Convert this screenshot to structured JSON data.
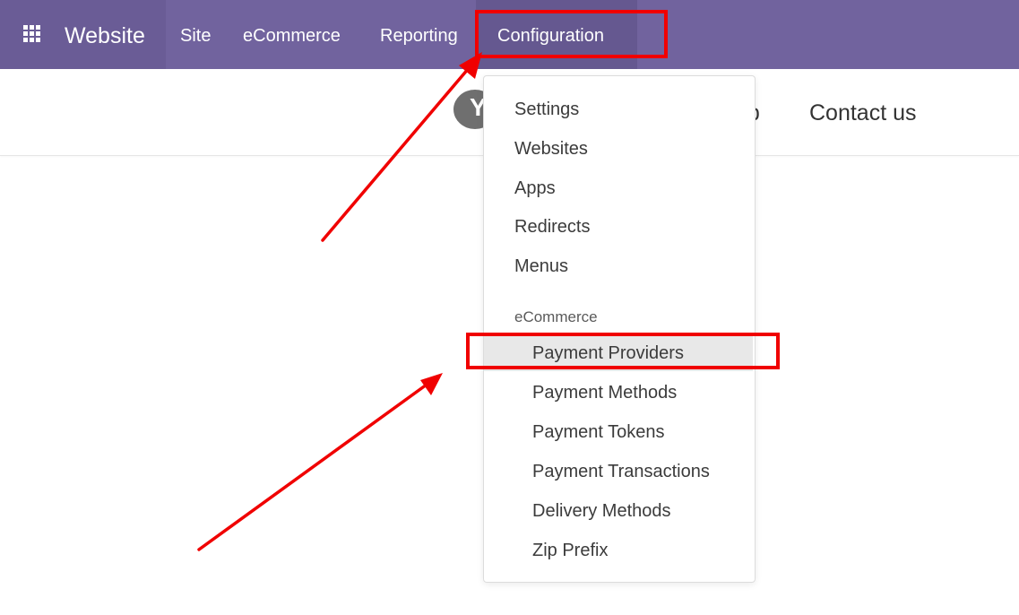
{
  "navbar": {
    "brand": "Website",
    "items": [
      {
        "label": "Site"
      },
      {
        "label": "eCommerce"
      },
      {
        "label": "Reporting"
      },
      {
        "label": "Configuration",
        "active": true
      }
    ],
    "apps_icon": "grid-icon"
  },
  "header": {
    "logo_letter": "Y",
    "links": [
      {
        "label": "op"
      },
      {
        "label": "Contact us"
      }
    ]
  },
  "dropdown": {
    "items": [
      {
        "label": "Settings"
      },
      {
        "label": "Websites"
      },
      {
        "label": "Apps"
      },
      {
        "label": "Redirects"
      },
      {
        "label": "Menus"
      }
    ],
    "section_header": "eCommerce",
    "section_items": [
      {
        "label": "Payment Providers",
        "highlighted": true
      },
      {
        "label": "Payment Methods"
      },
      {
        "label": "Payment Tokens"
      },
      {
        "label": "Payment Transactions"
      },
      {
        "label": "Delivery Methods"
      },
      {
        "label": "Zip Prefix"
      }
    ]
  },
  "colors": {
    "navbar": "#71639e",
    "annotation": "#f00000",
    "highlight": "#e8e8e8"
  }
}
